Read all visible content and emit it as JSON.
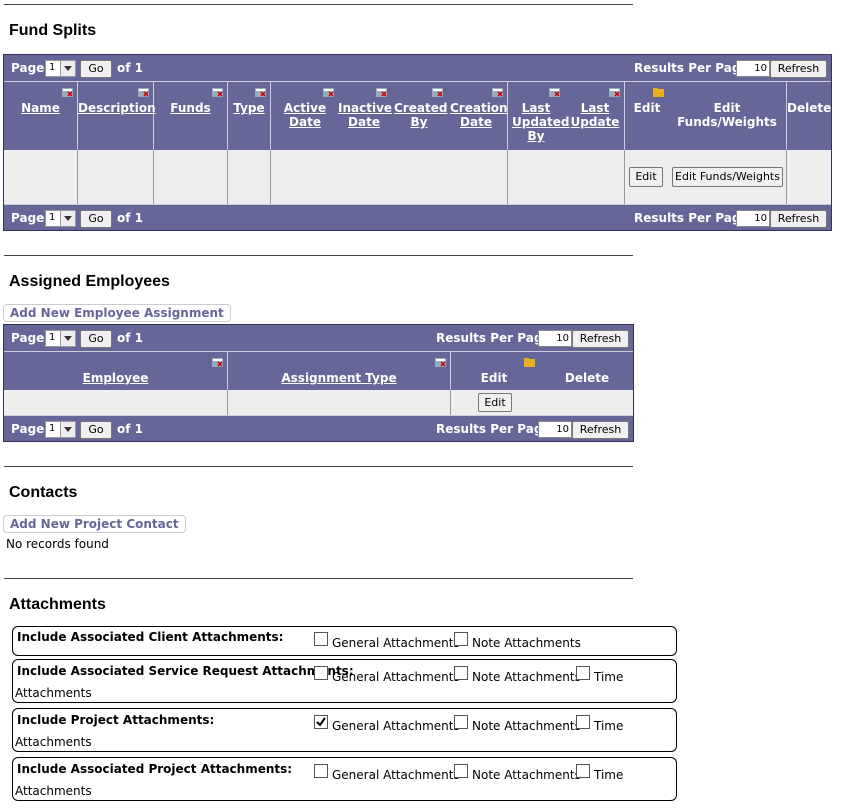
{
  "fund_splits": {
    "title": "Fund Splits",
    "pager": {
      "page_label": "Page",
      "page_value": "1",
      "go": "Go",
      "of": "of 1",
      "rpp_label": "Results Per Page",
      "rpp_value": "10",
      "refresh": "Refresh"
    },
    "columns": [
      "Name",
      "Description",
      "Funds",
      "Type",
      "Active Date",
      "Inactive Date",
      "Created By",
      "Creation Date",
      "Last Updated By",
      "Last Update",
      "Edit",
      "Edit Funds/Weights",
      "Delete"
    ],
    "row": {
      "edit_button": "Edit",
      "edit_funds_button": "Edit Funds/Weights"
    }
  },
  "assigned_employees": {
    "title": "Assigned Employees",
    "add_button": "Add New Employee Assignment",
    "pager": {
      "page_label": "Page",
      "page_value": "1",
      "go": "Go",
      "of": "of 1",
      "rpp_label": "Results Per Page",
      "rpp_value": "10",
      "refresh": "Refresh"
    },
    "columns": [
      "Employee",
      "Assignment Type",
      "Edit",
      "Delete"
    ],
    "row": {
      "edit_button": "Edit"
    }
  },
  "contacts": {
    "title": "Contacts",
    "add_button": "Add New Project Contact",
    "empty": "No records found"
  },
  "attachments": {
    "title": "Attachments",
    "general": "General Attachments",
    "note": "Note Attachments",
    "time": "Time",
    "sub": "Attachments",
    "groups": [
      {
        "label": "Include Associated Client Attachments:",
        "general_checked": false
      },
      {
        "label": "Include Associated Service Request Attachments:",
        "general_checked": false
      },
      {
        "label": "Include Project Attachments:",
        "general_checked": true
      },
      {
        "label": "Include Associated Project Attachments:",
        "general_checked": false
      }
    ]
  },
  "colors": {
    "grid_header": "#666699",
    "row_bg": "#eeeeee",
    "link": "#666699"
  }
}
